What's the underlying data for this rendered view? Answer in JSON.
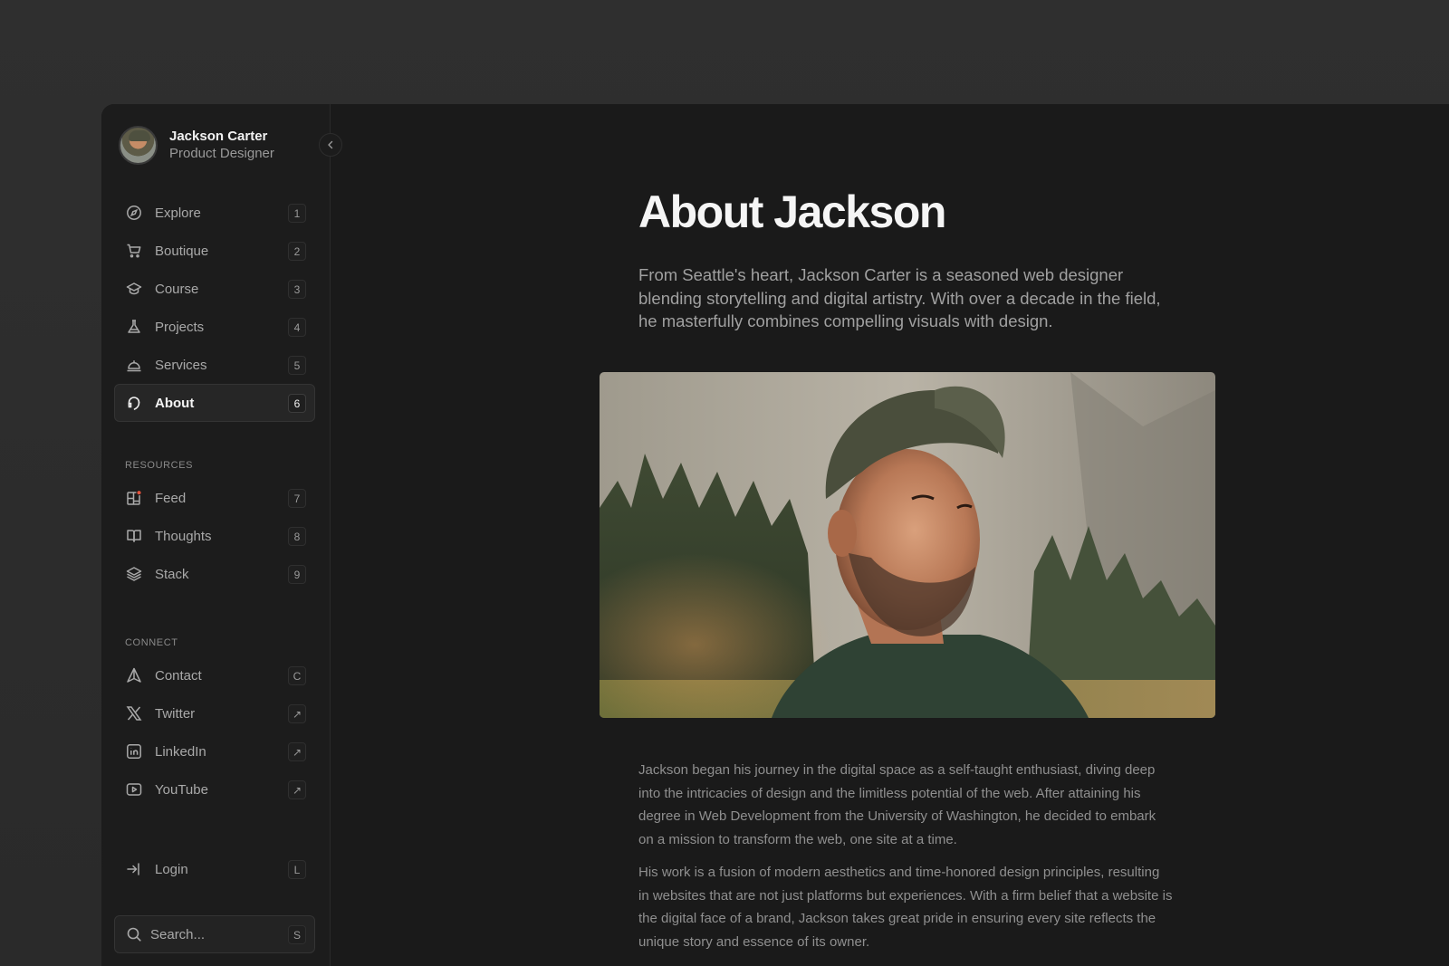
{
  "profile": {
    "name": "Jackson Carter",
    "role": "Product Designer"
  },
  "nav_main": [
    {
      "label": "Explore",
      "key": "1",
      "icon": "compass-icon"
    },
    {
      "label": "Boutique",
      "key": "2",
      "icon": "cart-icon"
    },
    {
      "label": "Course",
      "key": "3",
      "icon": "graduation-cap-icon"
    },
    {
      "label": "Projects",
      "key": "4",
      "icon": "flask-icon"
    },
    {
      "label": "Services",
      "key": "5",
      "icon": "service-bell-icon"
    },
    {
      "label": "About",
      "key": "6",
      "icon": "headphones-icon",
      "active": true
    }
  ],
  "resources": {
    "label": "RESOURCES",
    "items": [
      {
        "label": "Feed",
        "key": "7",
        "icon": "feed-icon",
        "badge_color": "#e5533d"
      },
      {
        "label": "Thoughts",
        "key": "8",
        "icon": "book-icon"
      },
      {
        "label": "Stack",
        "key": "9",
        "icon": "layers-icon"
      }
    ]
  },
  "connect": {
    "label": "CONNECT",
    "items": [
      {
        "label": "Contact",
        "key": "C",
        "icon": "send-icon"
      },
      {
        "label": "Twitter",
        "key": "↗",
        "icon": "x-logo-icon"
      },
      {
        "label": "LinkedIn",
        "key": "↗",
        "icon": "linkedin-icon"
      },
      {
        "label": "YouTube",
        "key": "↗",
        "icon": "youtube-icon"
      }
    ]
  },
  "login": {
    "label": "Login",
    "key": "L"
  },
  "search": {
    "placeholder": "Search...",
    "key": "S"
  },
  "main": {
    "title": "About Jackson",
    "lead": "From Seattle's heart, Jackson Carter is a seasoned web designer blending storytelling and digital artistry. With over a decade in the field, he masterfully combines compelling visuals with design.",
    "paragraphs": [
      "Jackson began his journey in the digital space as a self-taught enthusiast, diving deep into the intricacies of design and the limitless potential of the web. After attaining his degree in Web Development from the University of Washington, he decided to embark on a mission to transform the web, one site at a time.",
      "His work is a fusion of modern aesthetics and time-honored design principles, resulting in websites that are not just platforms but experiences. With a firm belief that a website is the digital face of a brand, Jackson takes great pride in ensuring every site reflects the unique story and essence of its owner."
    ]
  },
  "colors": {
    "window_bg": "#1a1a1a",
    "sidebar_bg": "#1c1c1c",
    "outer_bg": "#2d2d2d",
    "accent_dot": "#e5533d"
  }
}
